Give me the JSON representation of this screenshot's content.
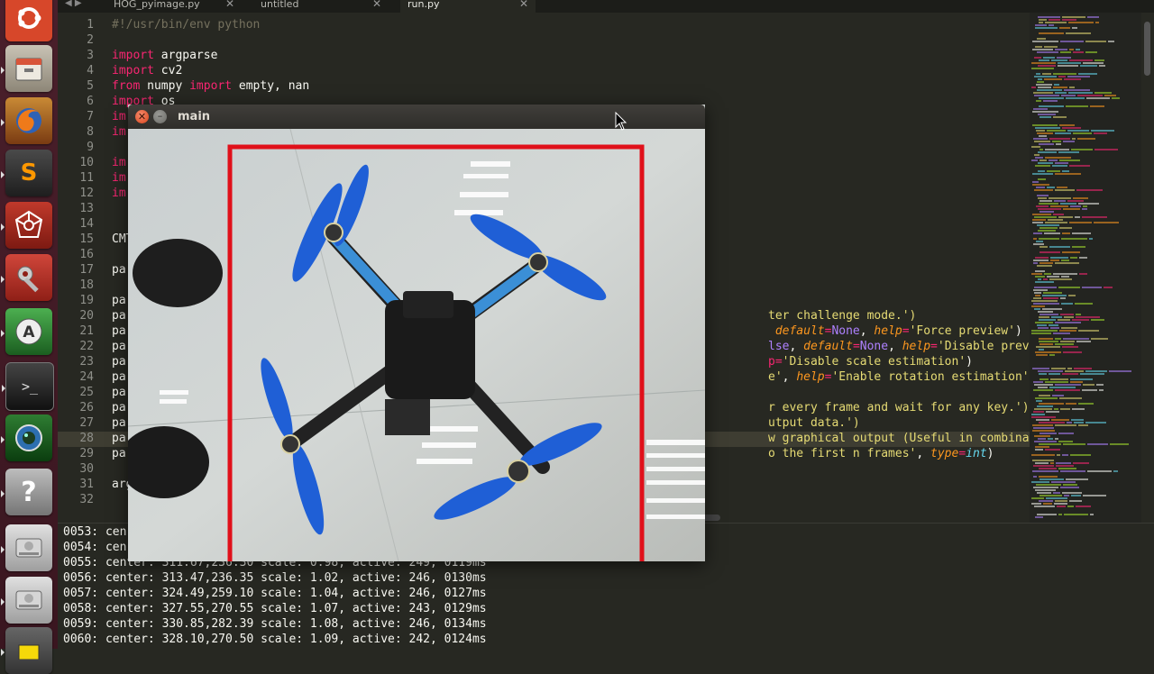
{
  "tabs": [
    {
      "label": "HOG_pyimage.py",
      "active": false
    },
    {
      "label": "untitled",
      "active": false
    },
    {
      "label": "run.py",
      "active": true
    }
  ],
  "tab_close_glyph": "✕",
  "editor": {
    "line_numbers": [
      "1",
      "2",
      "3",
      "4",
      "5",
      "6",
      "7",
      "8",
      "9",
      "10",
      "11",
      "12",
      "13",
      "14",
      "15",
      "16",
      "17",
      "18",
      "19",
      "20",
      "21",
      "22",
      "23",
      "24",
      "25",
      "26",
      "27",
      "28",
      "29",
      "30",
      "31",
      "32"
    ],
    "line1": "#!/usr/bin/env python",
    "line3_kw": "import",
    "line3_rest": " argparse",
    "line4_kw": "import",
    "line4_rest": " cv2",
    "line5_kw1": "from",
    "line5_mid": " numpy ",
    "line5_kw2": "import",
    "line5_rest": " empty, nan",
    "line6_kw": "import",
    "line6_rest": " os",
    "line7": "im",
    "line8": "im",
    "line10": "im",
    "line11": "im",
    "line12": "im",
    "line15": "CMT",
    "line17": "pa",
    "line19": "pa",
    "line20": "pa",
    "line21": "pa",
    "line22": "pa",
    "line23": "pa",
    "line24": "pa",
    "line25": "pa",
    "line26": "pa",
    "line27": "pa",
    "line28": "pa",
    "line29": "pa",
    "line31": "arg",
    "r20": "ter challenge mode.')",
    "r21a": " default",
    "r21b": "=",
    "r21c": "None",
    "r21d": ", ",
    "r21e": "help",
    "r21f": "=",
    "r21g": "'Force preview'",
    "r21h": ")",
    "r22a": "lse",
    "r22b": ", ",
    "r22c": "default",
    "r22d": "=",
    "r22e": "None",
    "r22f": ", ",
    "r22g": "help",
    "r22h": "=",
    "r22i": "'Disable preview'",
    "r22j": ")",
    "r23a": "p=",
    "r23b": "'Disable scale estimation'",
    "r23c": ")",
    "r24a": "e'",
    "r24b": ", ",
    "r24c": "help",
    "r24d": "=",
    "r24e": "'Enable rotation estimation'",
    "r24f": ")",
    "r26": "r every frame and wait for any key.')",
    "r27": "utput data.')",
    "r28": "w graphical output (Useful in combination with",
    "r29a": "o the first n frames'",
    "r29b": ", ",
    "r29c": "type",
    "r29d": "=",
    "r29e": "int",
    "r29f": ")"
  },
  "console": {
    "lines": [
      "0053: cen",
      "0054: cen",
      "0055: center: 311.67,236.30 scale: 0.98, active: 249, 0119ms",
      "0056: center: 313.47,236.35 scale: 1.02, active: 246, 0130ms",
      "0057: center: 324.49,259.10 scale: 1.04, active: 246, 0127ms",
      "0058: center: 327.55,270.55 scale: 1.07, active: 243, 0129ms",
      "0059: center: 330.85,282.39 scale: 1.08, active: 246, 0134ms",
      "0060: center: 328.10,270.50 scale: 1.09, active: 242, 0124ms"
    ]
  },
  "cv_window": {
    "title": "main",
    "close_glyph": "✕",
    "min_glyph": "–",
    "box_color": "#e0101a"
  },
  "launcher": {
    "icons": [
      "ubuntu-dash-icon",
      "files-icon",
      "firefox-icon",
      "sublime-text-icon",
      "network-icon",
      "system-settings-icon",
      "software-updater-icon",
      "terminal-icon",
      "camera-app-icon",
      "help-icon",
      "disk-icon",
      "disk-icon",
      "notes-icon"
    ],
    "help_glyph": "?",
    "terminal_glyph": ">_",
    "sublime_glyph": "S"
  },
  "colors": {
    "editor_bg": "#272822",
    "keyword": "#f92672",
    "string": "#e6db74",
    "constant": "#ae81ff",
    "builtin": "#66d9ef",
    "argument": "#fd971f"
  }
}
